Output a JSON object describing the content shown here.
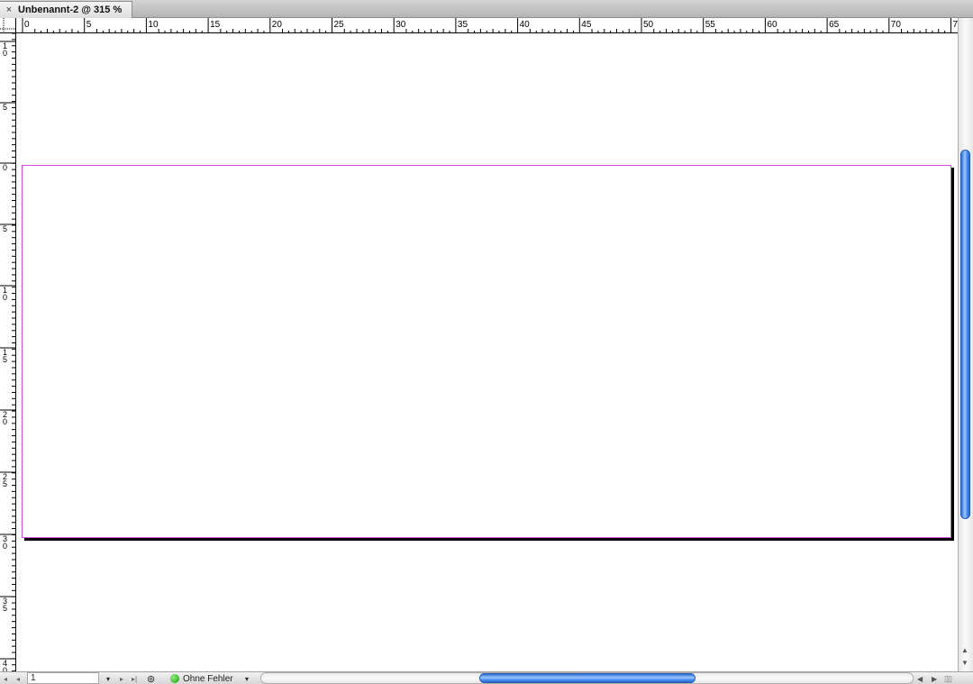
{
  "document_tab": {
    "close_glyph": "×",
    "title": "Unbenannt-2 @ 315 %"
  },
  "rulers": {
    "horizontal_labels": [
      "0",
      "5",
      "10",
      "15",
      "20",
      "25",
      "30",
      "35",
      "40",
      "45",
      "50",
      "55",
      "60",
      "65",
      "70",
      "7"
    ],
    "vertical_labels": [
      "1\n0",
      "5",
      "0",
      "5",
      "1\n0",
      "1\n5",
      "2\n0",
      "2\n5",
      "3\n0",
      "3\n5",
      "4\n0"
    ]
  },
  "statusbar": {
    "page_number": "1",
    "first_page_glyph": "◂",
    "prev_page_glyph": "◂",
    "next_page_glyph": "▸",
    "last_page_glyph": "▸|",
    "dropdown_glyph": "▾",
    "preflight_status": "Ohne Fehler",
    "status_color": "#1f9a10"
  },
  "colors": {
    "page_border": "#d44fd4",
    "scroll_thumb": "#4b8ff0"
  }
}
